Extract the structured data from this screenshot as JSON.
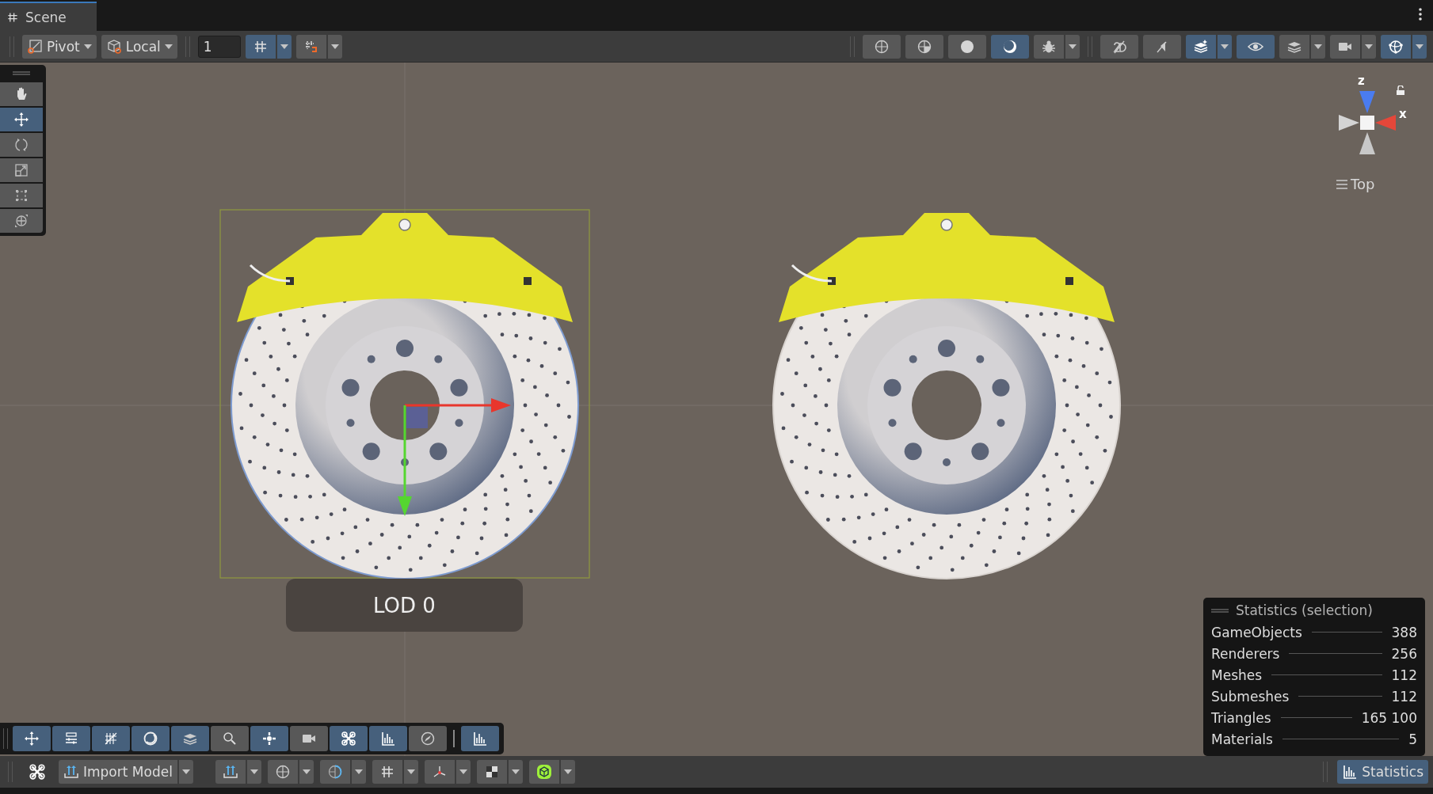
{
  "tab": {
    "title": "Scene"
  },
  "toolbar": {
    "pivot": {
      "label": "Pivot"
    },
    "space": {
      "label": "Local"
    },
    "increment": {
      "value": "1"
    },
    "snap_buttons": [
      {
        "kind": "grid-snap",
        "selected": true,
        "dropdown": true
      },
      {
        "kind": "snap",
        "selected": false,
        "dropdown": true
      }
    ],
    "shading_buttons": [
      {
        "kind": "wire-sphere",
        "selected": false,
        "dropdown": false
      },
      {
        "kind": "shaded-wire",
        "selected": false,
        "dropdown": false
      },
      {
        "kind": "disc",
        "selected": false,
        "dropdown": false
      },
      {
        "kind": "crescent",
        "selected": true,
        "dropdown": false
      },
      {
        "kind": "bug",
        "selected": false,
        "dropdown": true
      }
    ],
    "scene_buttons": [
      {
        "kind": "slash",
        "selected": false,
        "dropdown": false
      },
      {
        "kind": "mute",
        "selected": false,
        "dropdown": false
      },
      {
        "kind": "effects",
        "selected": true,
        "dropdown": true
      },
      {
        "kind": "eye",
        "selected": true,
        "dropdown": false
      },
      {
        "kind": "layers",
        "selected": false,
        "dropdown": true
      },
      {
        "kind": "camera",
        "selected": false,
        "dropdown": true
      },
      {
        "kind": "gizmo",
        "selected": true,
        "dropdown": true
      }
    ]
  },
  "tools": [
    {
      "kind": "hand",
      "selected": false
    },
    {
      "kind": "move",
      "selected": true
    },
    {
      "kind": "rotate",
      "selected": false
    },
    {
      "kind": "scale",
      "selected": false
    },
    {
      "kind": "rect",
      "selected": false
    },
    {
      "kind": "transform",
      "selected": false
    }
  ],
  "orientation_gizmo": {
    "z_label": "z",
    "x_label": "x",
    "view": "Top"
  },
  "lod_label": "LOD 0",
  "overlay_toolbar": [
    {
      "kind": "move",
      "selected": true
    },
    {
      "kind": "sliders",
      "selected": true
    },
    {
      "kind": "hatch",
      "selected": true
    },
    {
      "kind": "disc-outline",
      "selected": true
    },
    {
      "kind": "layers",
      "selected": true
    },
    {
      "kind": "search",
      "selected": false
    },
    {
      "kind": "light",
      "selected": true
    },
    {
      "kind": "camera",
      "selected": false
    },
    {
      "kind": "cross",
      "selected": true
    },
    {
      "kind": "chart",
      "selected": true
    },
    {
      "kind": "compass",
      "selected": false
    }
  ],
  "overlay_extra": [
    {
      "kind": "chart",
      "selected": true
    }
  ],
  "statistics": {
    "title": "Statistics (selection)",
    "rows": [
      {
        "label": "GameObjects",
        "value": "388"
      },
      {
        "label": "Renderers",
        "value": "256"
      },
      {
        "label": "Meshes",
        "value": "112"
      },
      {
        "label": "Submeshes",
        "value": "112"
      },
      {
        "label": "Triangles",
        "value": "165 100"
      },
      {
        "label": "Materials",
        "value": "5"
      }
    ]
  },
  "bottom_bar": {
    "import": {
      "label": "Import Model"
    },
    "tools": [
      {
        "kind": "upload"
      },
      {
        "kind": "wire-sphere"
      },
      {
        "kind": "half-sphere"
      },
      {
        "kind": "grid-snap"
      },
      {
        "kind": "axes"
      },
      {
        "kind": "checker"
      },
      {
        "kind": "cube-green"
      }
    ],
    "statistics_button": {
      "label": "Statistics",
      "selected": true
    }
  }
}
